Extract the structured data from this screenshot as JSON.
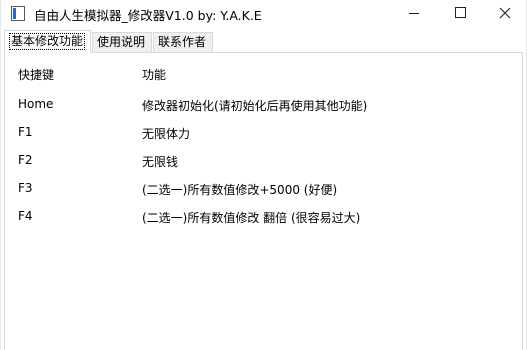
{
  "window": {
    "title": "自由人生模拟器_修改器V1.0 by: Y.A.K.E"
  },
  "tabs": [
    {
      "label": "基本修改功能"
    },
    {
      "label": "使用说明"
    },
    {
      "label": "联系作者"
    }
  ],
  "table": {
    "header": {
      "key": "快捷键",
      "function": "功能"
    },
    "rows": [
      {
        "key": "Home",
        "function": "修改器初始化(请初始化后再使用其他功能)"
      },
      {
        "key": "F1",
        "function": "无限体力"
      },
      {
        "key": "F2",
        "function": "无限钱"
      },
      {
        "key": "F3",
        "function": "(二选一)所有数值修改+5000 (好便)"
      },
      {
        "key": "F4",
        "function": "(二选一)所有数值修改 翻倍 (很容易过大)"
      }
    ]
  }
}
